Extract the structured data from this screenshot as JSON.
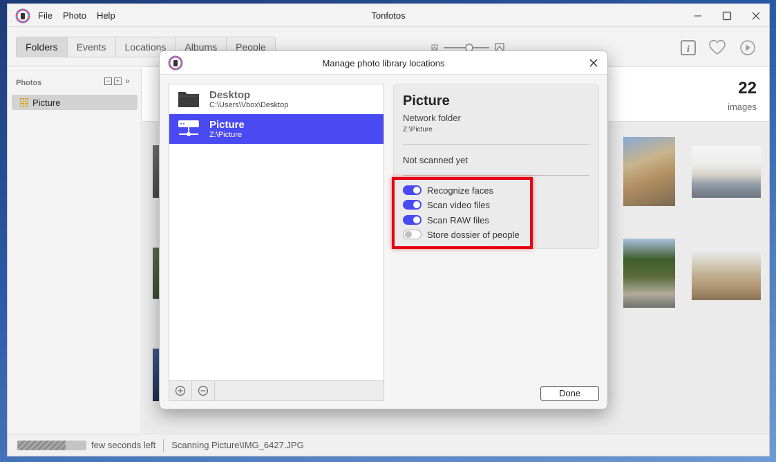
{
  "window": {
    "title": "Tonfotos",
    "menu": [
      "File",
      "Photo",
      "Help"
    ]
  },
  "toolbar": {
    "tabs": [
      "Folders",
      "Events",
      "Locations",
      "Albums",
      "People"
    ],
    "active_tab": "Folders",
    "icons": [
      "zoom-out-icon",
      "zoom-slider",
      "zoom-in-icon",
      "info-icon",
      "heart-icon",
      "play-icon"
    ]
  },
  "sidebar": {
    "heading": "Photos",
    "items": [
      {
        "label": "Picture",
        "icon": "folder-grid-icon"
      }
    ]
  },
  "content": {
    "count": "22",
    "count_label": "images"
  },
  "status": {
    "progress": 0.7,
    "time_left": "few seconds left",
    "message": "Scanning Picture\\IMG_6427.JPG"
  },
  "dialog": {
    "title": "Manage photo library locations",
    "locations": [
      {
        "name": "Desktop",
        "path": "C:\\Users\\Vbox\\Desktop",
        "icon": "folder-icon",
        "selected": false
      },
      {
        "name": "Picture",
        "path": "Z:\\Picture",
        "icon": "network-folder-icon",
        "selected": true
      }
    ],
    "detail": {
      "name": "Picture",
      "type": "Network folder",
      "path": "Z:\\Picture",
      "scan_status": "Not scanned yet",
      "options": [
        {
          "label": "Recognize faces",
          "enabled": true
        },
        {
          "label": "Scan video files",
          "enabled": true
        },
        {
          "label": "Scan RAW files",
          "enabled": true
        },
        {
          "label": "Store dossier of people",
          "enabled": false
        }
      ]
    },
    "done_label": "Done",
    "accent_color": "#4a4af2",
    "highlight_color": "#e60012"
  }
}
